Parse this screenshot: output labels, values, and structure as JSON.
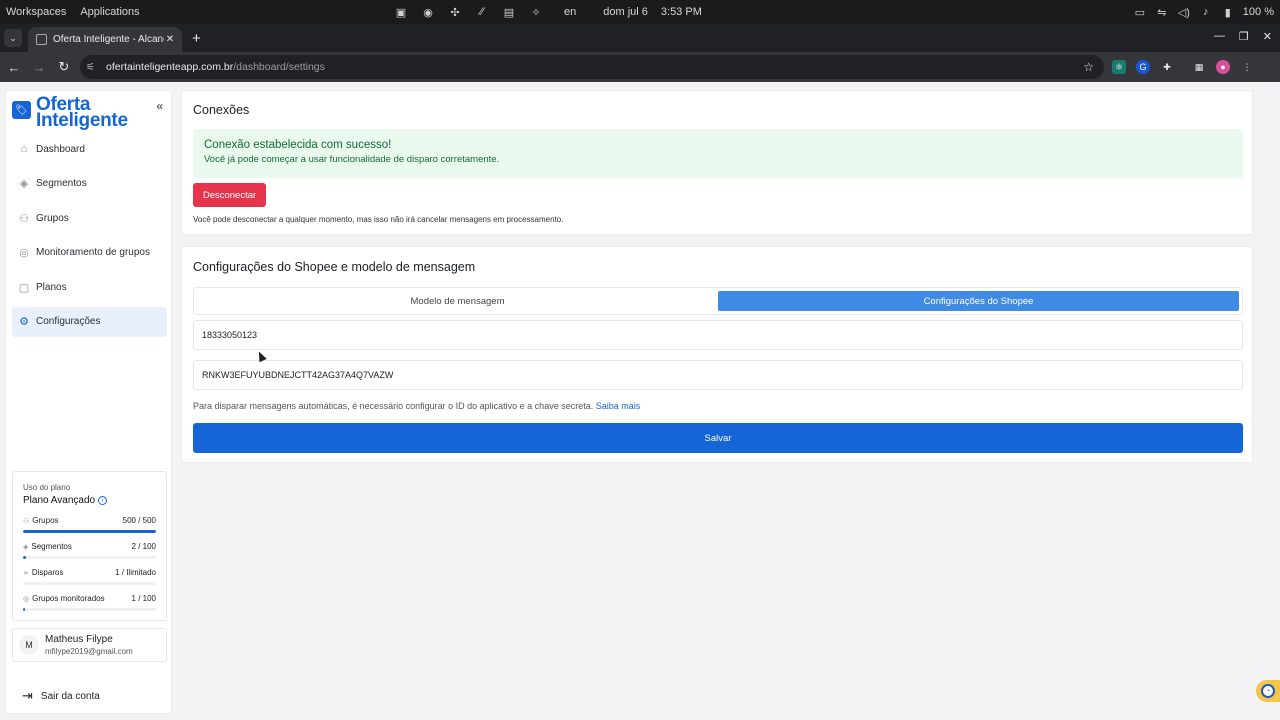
{
  "os": {
    "workspaces": "Workspaces",
    "applications": "Applications",
    "lang": "en",
    "date": "dom jul 6",
    "time": "3:53 PM",
    "battery": "100 %"
  },
  "browser": {
    "tab_title": "Oferta Inteligente - Alcance",
    "url_domain": "ofertainteligenteapp.com.br",
    "url_path": "/dashboard/settings"
  },
  "sidebar": {
    "brand_line1": "Oferta",
    "brand_line2": "Inteligente",
    "collapse_glyph": "«",
    "items": [
      {
        "label": "Dashboard",
        "icon": "home-icon",
        "glyph": "⌂"
      },
      {
        "label": "Segmentos",
        "icon": "layers-icon",
        "glyph": "◈"
      },
      {
        "label": "Grupos",
        "icon": "users-icon",
        "glyph": "⚇"
      },
      {
        "label": "Monitoramento de grupos",
        "icon": "monitor-icon",
        "glyph": "◎"
      },
      {
        "label": "Planos",
        "icon": "package-icon",
        "glyph": "▢"
      },
      {
        "label": "Configurações",
        "icon": "gear-icon",
        "glyph": "⚙"
      }
    ],
    "plan": {
      "caption": "Uso do plano",
      "name": "Plano Avançado",
      "usage": [
        {
          "label": "Grupos",
          "value": "500 / 500",
          "fraction": 1.0,
          "icon": "users-icon"
        },
        {
          "label": "Segmentos",
          "value": "2 / 100",
          "fraction": 0.02,
          "icon": "layers-icon"
        },
        {
          "label": "Disparos",
          "value": "1 / Ilimitado",
          "fraction": 0.0,
          "icon": "send-icon"
        },
        {
          "label": "Grupos monitorados",
          "value": "1 / 100",
          "fraction": 0.01,
          "icon": "monitor-icon"
        }
      ]
    },
    "user": {
      "initial": "M",
      "name": "Matheus Filype",
      "email": "mfilype2019@gmail.com"
    },
    "logout_label": "Sair da conta"
  },
  "connections": {
    "title": "Conexões",
    "success_title": "Conexão estabelecida com sucesso!",
    "success_message": "Você já pode começar a usar funcionalidade de disparo corretamente.",
    "disconnect_label": "Desconectar",
    "disconnect_note": "Você pode desconectar a qualquer momento, mas isso não irá cancelar mensagens em processamento."
  },
  "shopee": {
    "title": "Configurações do Shopee e modelo de mensagem",
    "tabs": [
      {
        "label": "Modelo de mensagem",
        "active": false
      },
      {
        "label": "Configurações do Shopee",
        "active": true
      }
    ],
    "app_id": "18333050123",
    "secret": "RNKW3EFUYUBDNEJCTT42AG37A4Q7VAZW",
    "help_text": "Para disparar mensagens automáticas, é necessário configurar o ID do aplicativo e a chave secreta.",
    "help_link": "Saiba mais",
    "save_label": "Salvar"
  },
  "colors": {
    "brand": "#1565d8",
    "danger": "#e6344c",
    "success_bg": "#e9f9ed",
    "success_text": "#166a35",
    "tab_active": "#3f8ae3"
  }
}
